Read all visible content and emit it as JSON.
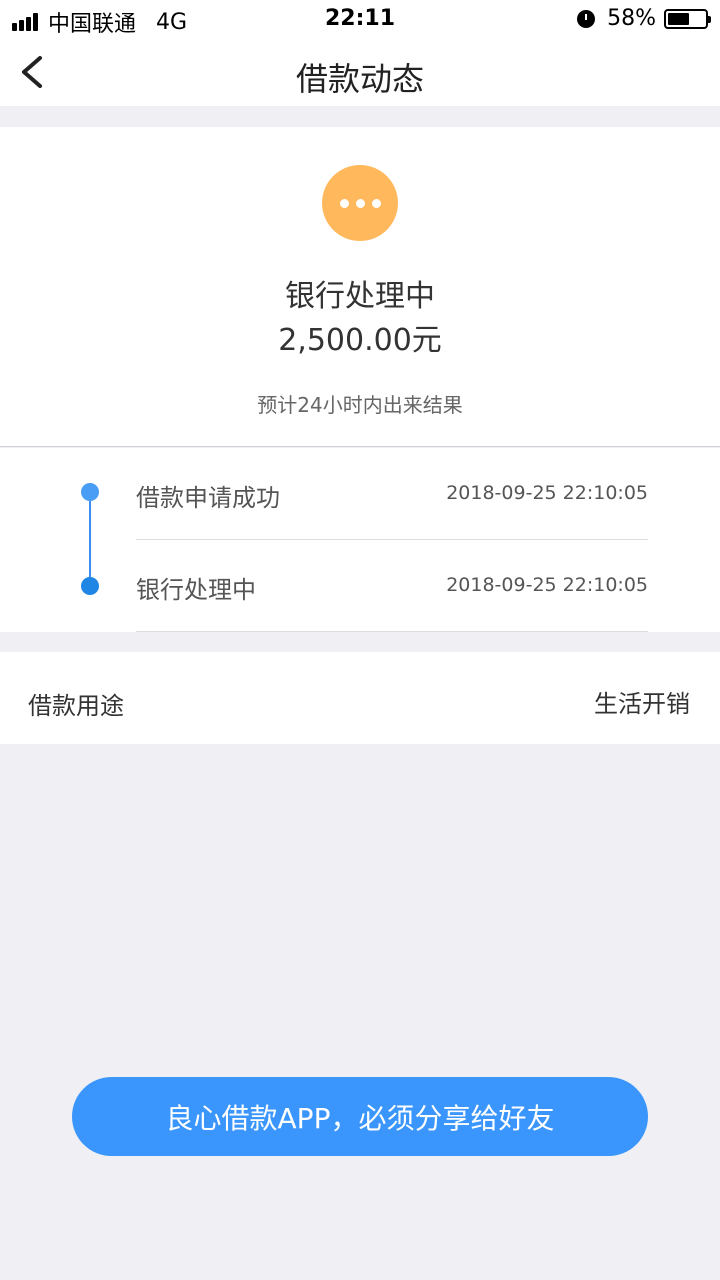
{
  "status_bar": {
    "carrier": "中国联通",
    "network": "4G",
    "time": "22:11",
    "battery_percent": "58%",
    "battery_level": 0.58
  },
  "nav": {
    "title": "借款动态"
  },
  "status_card": {
    "title": "银行处理中",
    "amount": "2,500.00元",
    "hint": "预计24小时内出来结果",
    "icon_color": "#ffb85c"
  },
  "timeline": [
    {
      "label": "借款申请成功",
      "time": "2018-09-25 22:10:05"
    },
    {
      "label": "银行处理中",
      "time": "2018-09-25 22:10:05"
    }
  ],
  "purpose": {
    "label": "借款用途",
    "value": "生活开销"
  },
  "share_button": {
    "label": "良心借款APP，必须分享给好友",
    "color": "#3a96fc"
  }
}
